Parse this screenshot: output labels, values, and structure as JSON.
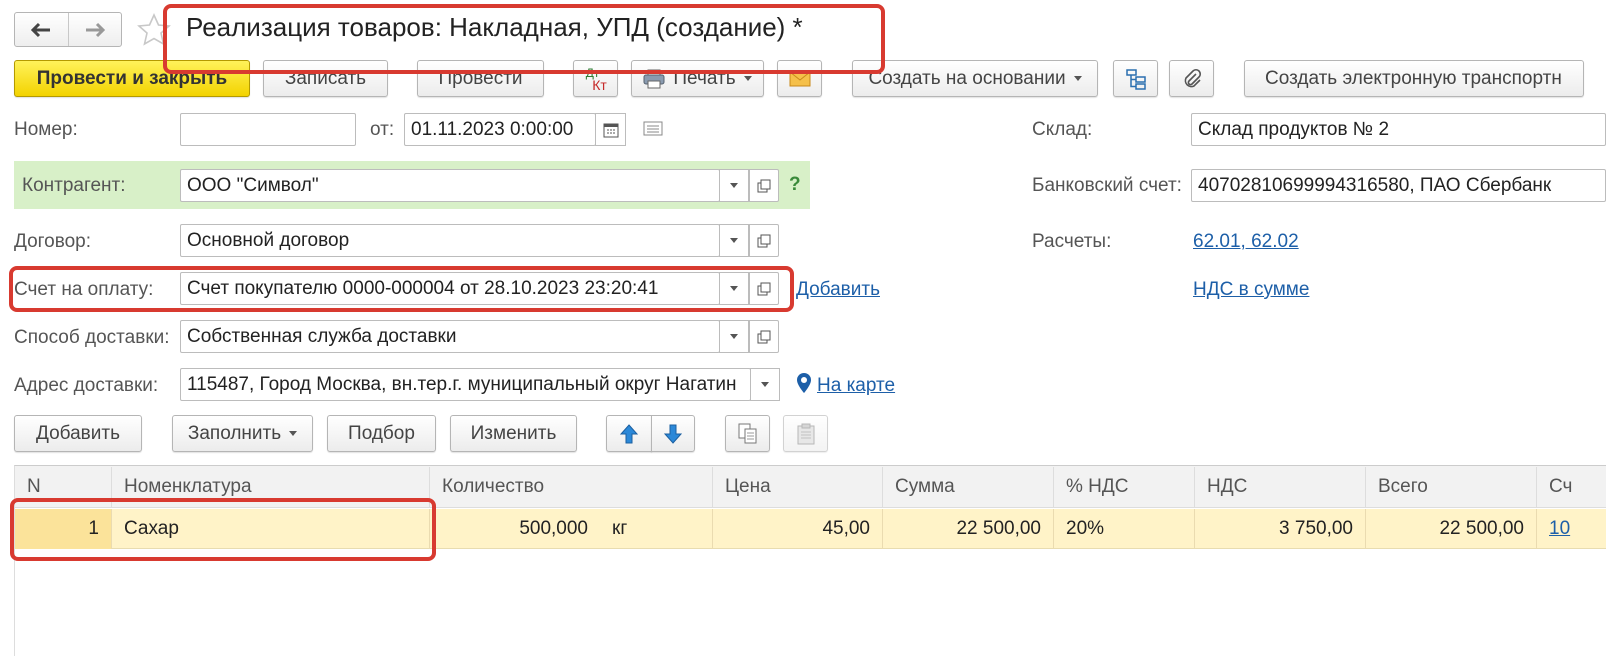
{
  "window": {
    "title": "Реализация товаров: Накладная, УПД (создание) *"
  },
  "toolbar": {
    "post_close": "Провести и закрыть",
    "save": "Записать",
    "post": "Провести",
    "dt_kt": "Дт",
    "kt": "Кт",
    "print": "Печать",
    "create_based": "Создать на основании",
    "create_electronic": "Создать электронную транспортн"
  },
  "form": {
    "number_label": "Номер:",
    "number_value": "",
    "date_label": "от:",
    "date_value": "01.11.2023  0:00:00",
    "warehouse_label": "Склад:",
    "warehouse_value": "Склад продуктов № 2",
    "counterparty_label": "Контрагент:",
    "counterparty_value": "ООО \"Символ\"",
    "help": "?",
    "bank_label": "Банковский счет:",
    "bank_value": "40702810699994316580, ПАО Сбербанк",
    "contract_label": "Договор:",
    "contract_value": "Основной договор",
    "settlements_label": "Расчеты:",
    "settlements_link": "62.01, 62.02",
    "invoice_label": "Счет на оплату:",
    "invoice_value": "Счет покупателю 0000-000004 от 28.10.2023 23:20:41",
    "invoice_add": "Добавить",
    "vat_link": "НДС в сумме",
    "delivery_method_label": "Способ доставки:",
    "delivery_method_value": "Собственная служба доставки",
    "delivery_address_label": "Адрес доставки:",
    "delivery_address_value": "115487, Город Москва, вн.тер.г. муниципальный округ Нагатин",
    "map_link": "На карте"
  },
  "table_toolbar": {
    "add": "Добавить",
    "fill": "Заполнить",
    "pick": "Подбор",
    "change": "Изменить"
  },
  "table": {
    "headers": [
      "N",
      "Номенклатура",
      "Количество",
      "Цена",
      "Сумма",
      "% НДС",
      "НДС",
      "Всего",
      "Сч"
    ],
    "row": {
      "n": "1",
      "item": "Сахар",
      "qty": "500,000",
      "unit": "кг",
      "price": "45,00",
      "sum": "22 500,00",
      "vat_rate": "20%",
      "vat": "3 750,00",
      "total": "22 500,00",
      "account": "10"
    }
  },
  "colors": {
    "highlight_red": "#d83a30",
    "primary_yellow": "#f3d300",
    "link_blue": "#1d5fa8",
    "counterparty_bg": "#d8f0c8",
    "row_selected": "#fff3c8"
  }
}
